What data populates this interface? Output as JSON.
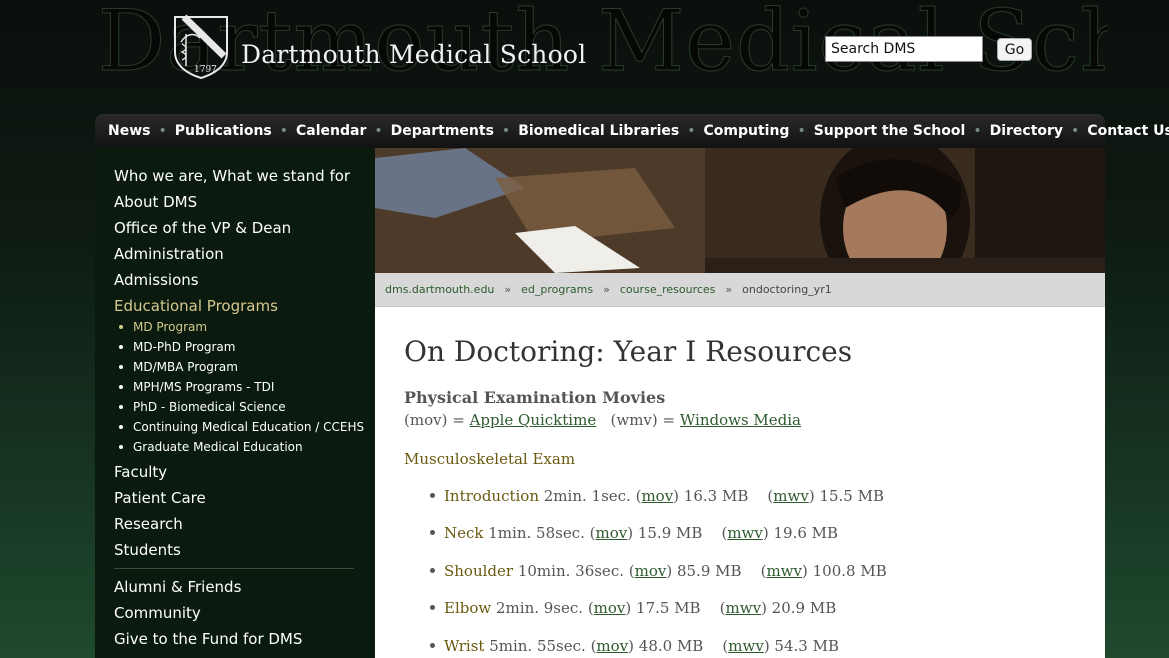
{
  "header": {
    "bg_title": "Dartmouth Medical School",
    "site_title": "Dartmouth Medical School",
    "logo_year": "1797",
    "search_value": "Search DMS",
    "go_label": "Go"
  },
  "nav": {
    "items": [
      "News",
      "Publications",
      "Calendar",
      "Departments",
      "Biomedical Libraries",
      "Computing",
      "Support the School",
      "Directory",
      "Contact Us"
    ]
  },
  "sidebar": {
    "main_items": [
      "Who we are, What we stand for",
      "About DMS",
      "Office of the VP & Dean",
      "Administration",
      "Admissions",
      "Educational Programs"
    ],
    "sub_items": [
      "MD Program",
      "MD-PhD Program",
      "MD/MBA Program",
      "MPH/MS Programs - TDI",
      "PhD - Biomedical Science",
      "Continuing Medical Education / CCEHS",
      "Graduate Medical Education"
    ],
    "more_items": [
      "Faculty",
      "Patient Care",
      "Research",
      "Students"
    ],
    "lower_items": [
      "Alumni & Friends",
      "Community",
      "Give to the Fund for DMS"
    ]
  },
  "breadcrumb": {
    "items": [
      "dms.dartmouth.edu",
      "ed_programs",
      "course_resources"
    ],
    "current": "ondoctoring_yr1",
    "separator": "»"
  },
  "content": {
    "page_title": "On Doctoring: Year I Resources",
    "subsection_title": "Physical Examination Movies",
    "format_mov": "(mov) = ",
    "format_mov_link": "Apple Quicktime",
    "format_wmv": "(wmv) = ",
    "format_wmv_link": "Windows Media",
    "exam_heading": "Musculoskeletal Exam",
    "movies": [
      {
        "name": "Introduction",
        "duration": " 2min. 1sec. (",
        "mov": "mov",
        "mov_size": ") 16.3 MB",
        "wmv": "mwv",
        "wmv_size": ") 15.5 MB"
      },
      {
        "name": "Neck",
        "duration": " 1min. 58sec. (",
        "mov": "mov",
        "mov_size": ") 15.9 MB",
        "wmv": "mwv",
        "wmv_size": ") 19.6 MB"
      },
      {
        "name": "Shoulder",
        "duration": " 10min. 36sec. (",
        "mov": "mov",
        "mov_size": ") 85.9 MB",
        "wmv": "mwv",
        "wmv_size": ") 100.8 MB"
      },
      {
        "name": "Elbow",
        "duration": " 2min. 9sec. (",
        "mov": "mov",
        "mov_size": ") 17.5 MB",
        "wmv": "mwv",
        "wmv_size": ") 20.9 MB"
      },
      {
        "name": "Wrist",
        "duration": " 5min. 55sec. (",
        "mov": "mov",
        "mov_size": ") 48.0 MB",
        "wmv": "mwv",
        "wmv_size": ") 54.3 MB"
      }
    ]
  }
}
